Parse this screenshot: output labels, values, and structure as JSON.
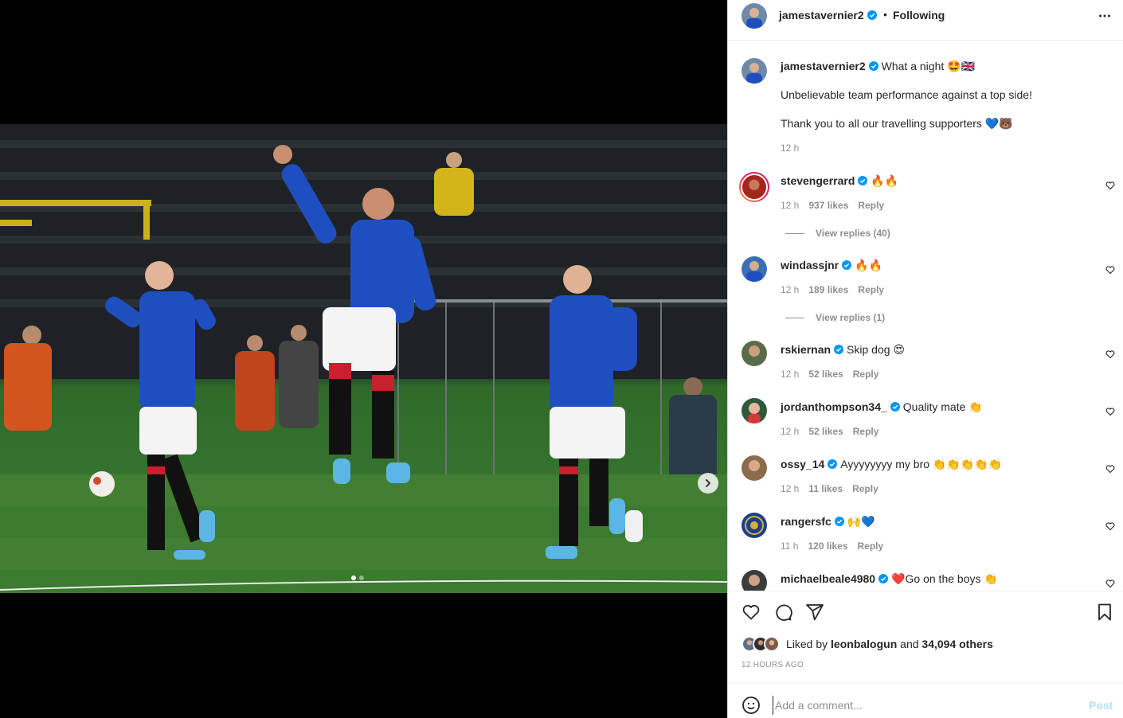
{
  "post": {
    "author": "jamestavernier2",
    "follow_status": "Following",
    "separator": "•",
    "caption_line1": "What a night 🤩🇬🇧",
    "caption_line2": "Unbelievable team performance against a top side!",
    "caption_line3": "Thank you to all our travelling supporters 💙🐻",
    "caption_time": "12 h"
  },
  "carousel": {
    "current_slide": 1,
    "total_slides": 2
  },
  "comments": [
    {
      "user": "stevengerrard",
      "text": "🔥🔥",
      "time": "12 h",
      "likes": "937 likes",
      "reply": "Reply",
      "view_replies": "View replies (40)"
    },
    {
      "user": "windassjnr",
      "text": "🔥🔥",
      "time": "12 h",
      "likes": "189 likes",
      "reply": "Reply",
      "view_replies": "View replies (1)"
    },
    {
      "user": "rskiernan",
      "text": "Skip dog 😍",
      "time": "12 h",
      "likes": "52 likes",
      "reply": "Reply"
    },
    {
      "user": "jordanthompson34_",
      "text": "Quality mate 👏",
      "time": "12 h",
      "likes": "52 likes",
      "reply": "Reply"
    },
    {
      "user": "ossy_14",
      "text": "Ayyyyyyyy my bro 👏👏👏👏👏",
      "time": "12 h",
      "likes": "11 likes",
      "reply": "Reply"
    },
    {
      "user": "rangersfc",
      "text": "🙌💙",
      "time": "11 h",
      "likes": "120 likes",
      "reply": "Reply"
    },
    {
      "user": "michaelbeale4980",
      "text": "❤️Go on the boys 👏"
    }
  ],
  "likes": {
    "prefix": "Liked by",
    "user": "leonbalogun",
    "joiner": "and",
    "others": "34,094 others"
  },
  "timestamp": "12 HOURS AGO",
  "composer": {
    "placeholder": "Add a comment...",
    "post_label": "Post"
  },
  "icons": {
    "more": "more-horizontal-icon",
    "verified": "verified-badge-icon",
    "like": "heart-icon",
    "comment": "comment-bubble-icon",
    "share": "paper-plane-icon",
    "save": "bookmark-icon",
    "emoji": "emoji-smile-icon",
    "next": "chevron-right-icon"
  },
  "colors": {
    "verified": "#0095f6",
    "post_button_disabled": "#b2dffc",
    "muted_text": "#8e8e8e",
    "kit_blue": "#1f4fbf"
  }
}
